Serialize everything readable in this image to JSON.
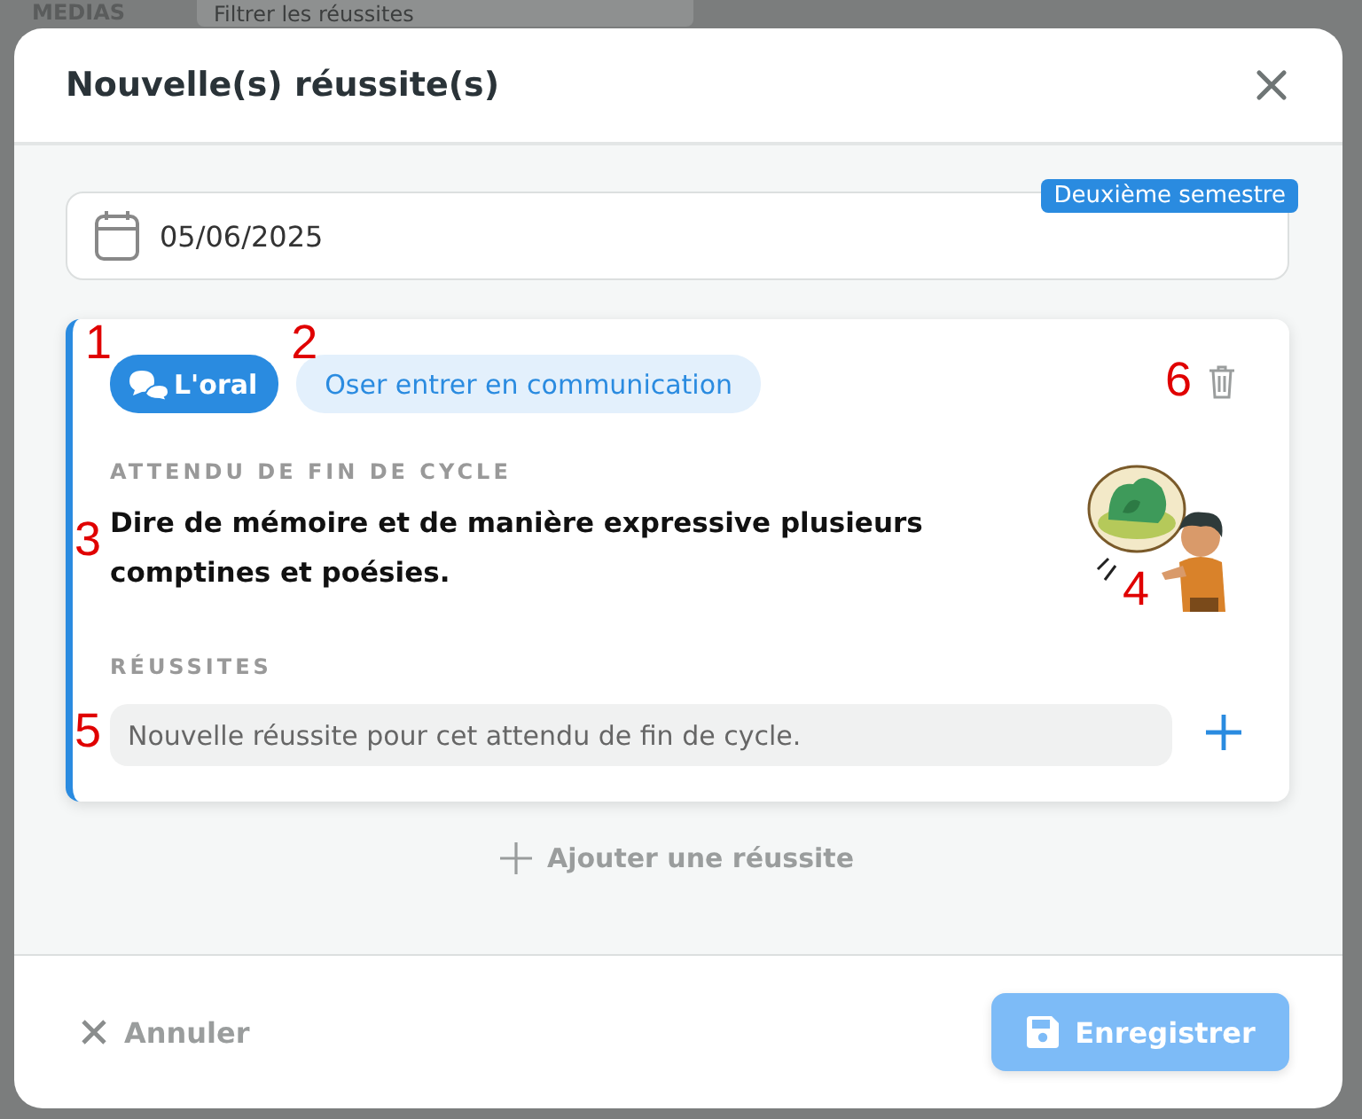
{
  "background": {
    "section_title": "MEDIAS",
    "search": {
      "placeholder": "Filtrer les réussites"
    }
  },
  "dialog": {
    "title": "Nouvelle(s) réussite(s)"
  },
  "date_field": {
    "value": "05/06/2025",
    "badge": "Deuxième semestre"
  },
  "entries": [
    {
      "category": {
        "label": "L'oral",
        "annotation": "1"
      },
      "subdomain": {
        "label": "Oser entrer en communication",
        "annotation": "2"
      },
      "delete_annotation": "6",
      "expectation_heading": "ATTENDU DE FIN DE CYCLE",
      "expectation": "Dire de mémoire et de manière expressive plusieurs comptines et poésies.",
      "expectation_annotation": "3",
      "illustration": {
        "kind": "picture",
        "annotation": "4"
      },
      "successes_heading": "RÉUSSITES",
      "new_success": {
        "placeholder": "Nouvelle réussite pour cet attendu de fin de cycle.",
        "annotation": "5"
      }
    }
  ],
  "add_success": "Ajouter une réussite",
  "footer": {
    "cancel": "Annuler",
    "save": {
      "label": "Enregistrer",
      "disabled": true
    }
  }
}
